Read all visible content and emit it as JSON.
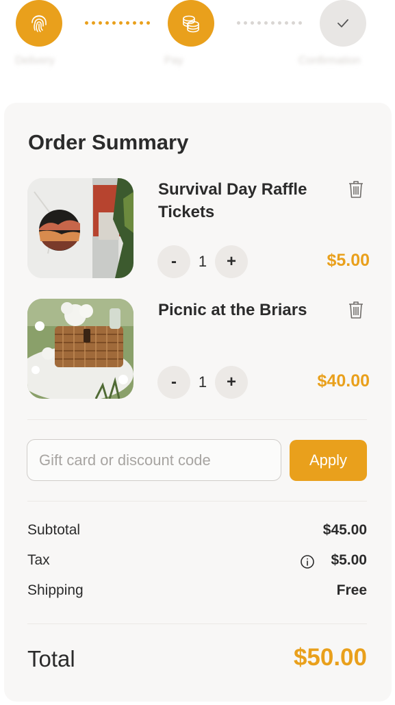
{
  "stepper": {
    "steps": [
      {
        "label": "Delivery",
        "icon": "fingerprint-icon",
        "state": "done"
      },
      {
        "label": "Pay",
        "icon": "coins-icon",
        "state": "active"
      },
      {
        "label": "Confirmation",
        "icon": "check-icon",
        "state": "todo"
      }
    ]
  },
  "summary": {
    "title": "Order Summary",
    "items": [
      {
        "name": "Survival Day Raffle Tickets",
        "qty": "1",
        "price": "$5.00",
        "minus": "-",
        "plus": "+"
      },
      {
        "name": "Picnic at the Briars",
        "qty": "1",
        "price": "$40.00",
        "minus": "-",
        "plus": "+"
      }
    ],
    "discount": {
      "placeholder": "Gift card or discount code",
      "value": "",
      "apply_label": "Apply"
    },
    "rows": {
      "subtotal": {
        "label": "Subtotal",
        "value": "$45.00"
      },
      "tax": {
        "label": "Tax",
        "value": "$5.00"
      },
      "shipping": {
        "label": "Shipping",
        "value": "Free"
      }
    },
    "total": {
      "label": "Total",
      "value": "$50.00"
    }
  },
  "colors": {
    "accent": "#e9a01c",
    "card": "#f8f7f6",
    "muted": "#e8e6e4"
  }
}
